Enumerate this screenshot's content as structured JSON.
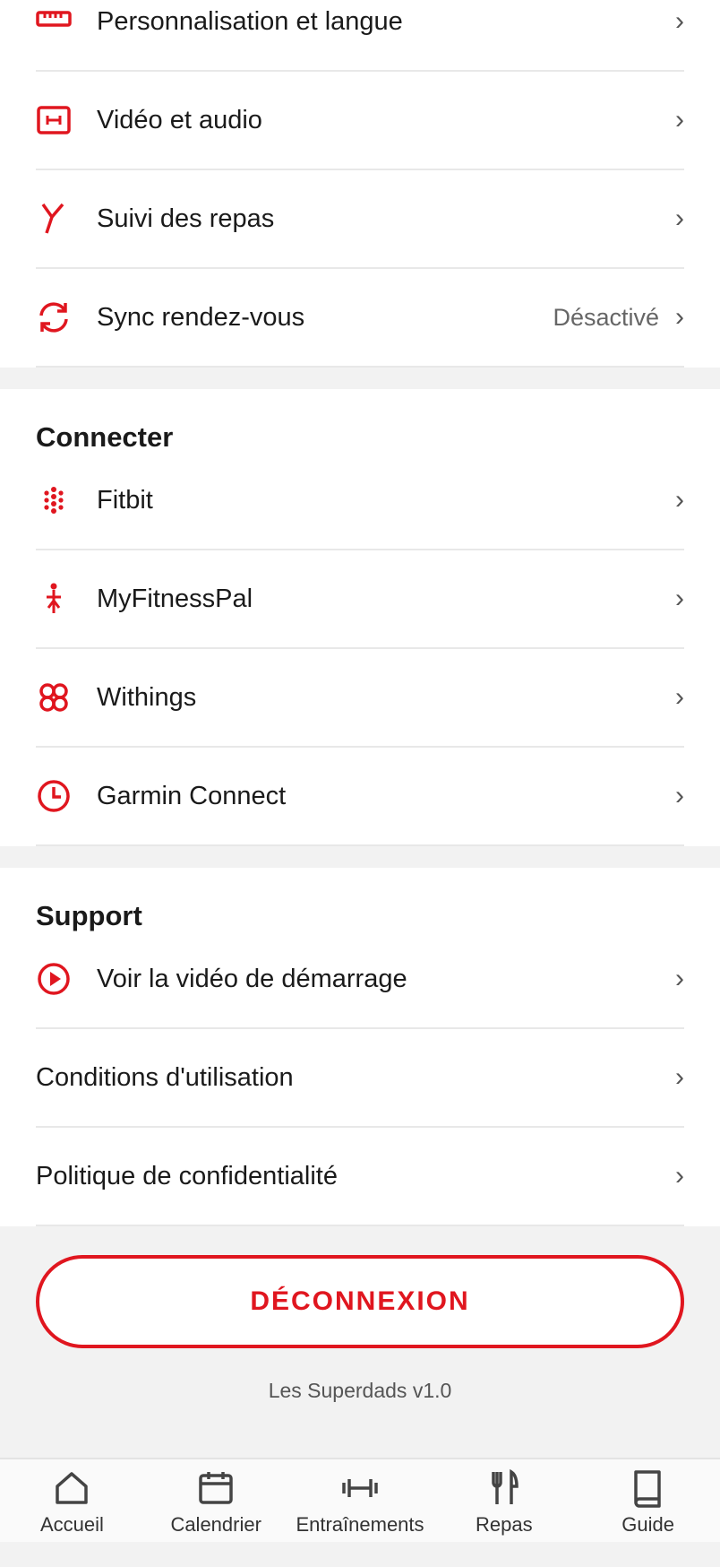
{
  "colors": {
    "accent": "#e0161f",
    "background": "#f2f2f2",
    "text": "#1a1a1a",
    "muted": "#666666"
  },
  "preferences": [
    {
      "label": "Personnalisation et langue",
      "icon": "ruler-icon",
      "value": ""
    },
    {
      "label": "Vidéo et audio",
      "icon": "video-audio-icon",
      "value": ""
    },
    {
      "label": "Suivi des repas",
      "icon": "meal-tracking-icon",
      "value": ""
    },
    {
      "label": "Sync rendez-vous",
      "icon": "sync-icon",
      "value": "Désactivé"
    }
  ],
  "connect": {
    "title": "Connecter",
    "items": [
      {
        "label": "Fitbit",
        "icon": "fitbit-icon"
      },
      {
        "label": "MyFitnessPal",
        "icon": "myfitnesspal-icon"
      },
      {
        "label": "Withings",
        "icon": "withings-icon"
      },
      {
        "label": "Garmin Connect",
        "icon": "garmin-icon"
      }
    ]
  },
  "support": {
    "title": "Support",
    "items": [
      {
        "label": "Voir la vidéo de démarrage",
        "icon": "play-circle-icon"
      },
      {
        "label": "Conditions d'utilisation"
      },
      {
        "label": "Politique de confidentialité"
      }
    ]
  },
  "chevron": "›",
  "logout_label": "DÉCONNEXION",
  "version": "Les Superdads v1.0",
  "tabs": [
    {
      "label": "Accueil",
      "icon": "home-icon"
    },
    {
      "label": "Calendrier",
      "icon": "calendar-icon"
    },
    {
      "label": "Entraînements",
      "icon": "dumbbell-icon"
    },
    {
      "label": "Repas",
      "icon": "fork-knife-icon"
    },
    {
      "label": "Guide",
      "icon": "book-icon"
    }
  ]
}
